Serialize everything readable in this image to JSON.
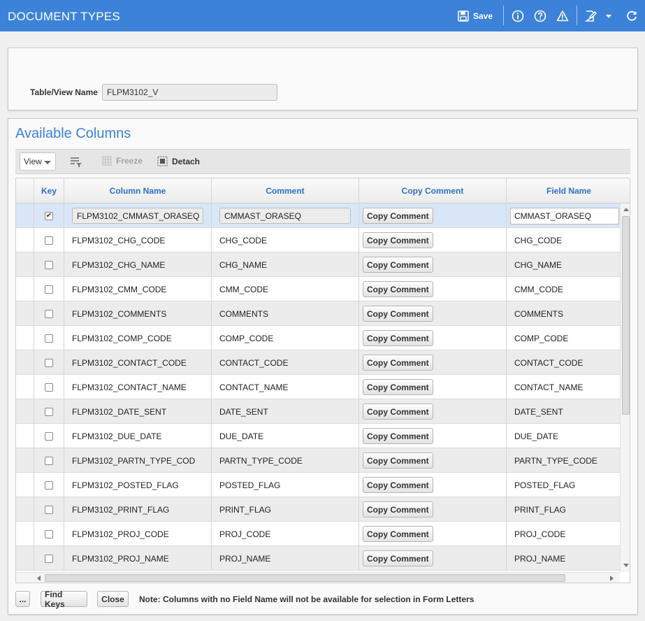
{
  "window": {
    "title": "DOCUMENT TYPES",
    "save_label": "Save"
  },
  "table_view": {
    "label": "Table/View Name",
    "value": "FLPM3102_V"
  },
  "section": {
    "title": "Available Columns"
  },
  "grid_toolbar": {
    "view_label": "View",
    "freeze_label": "Freeze",
    "detach_label": "Detach"
  },
  "grid": {
    "headers": {
      "key": "Key",
      "column_name": "Column Name",
      "comment": "Comment",
      "copy_comment": "Copy Comment",
      "field_name": "Field Name"
    },
    "copy_button_label": "Copy Comment",
    "rows": [
      {
        "key": true,
        "column": "FLPM3102_CMMAST_ORASEQ",
        "comment": "CMMAST_ORASEQ",
        "field": "CMMAST_ORASEQ"
      },
      {
        "key": false,
        "column": "FLPM3102_CHG_CODE",
        "comment": "CHG_CODE",
        "field": "CHG_CODE"
      },
      {
        "key": false,
        "column": "FLPM3102_CHG_NAME",
        "comment": "CHG_NAME",
        "field": "CHG_NAME"
      },
      {
        "key": false,
        "column": "FLPM3102_CMM_CODE",
        "comment": "CMM_CODE",
        "field": "CMM_CODE"
      },
      {
        "key": false,
        "column": "FLPM3102_COMMENTS",
        "comment": "COMMENTS",
        "field": "COMMENTS"
      },
      {
        "key": false,
        "column": "FLPM3102_COMP_CODE",
        "comment": "COMP_CODE",
        "field": "COMP_CODE"
      },
      {
        "key": false,
        "column": "FLPM3102_CONTACT_CODE",
        "comment": "CONTACT_CODE",
        "field": "CONTACT_CODE"
      },
      {
        "key": false,
        "column": "FLPM3102_CONTACT_NAME",
        "comment": "CONTACT_NAME",
        "field": "CONTACT_NAME"
      },
      {
        "key": false,
        "column": "FLPM3102_DATE_SENT",
        "comment": "DATE_SENT",
        "field": "DATE_SENT"
      },
      {
        "key": false,
        "column": "FLPM3102_DUE_DATE",
        "comment": "DUE_DATE",
        "field": "DUE_DATE"
      },
      {
        "key": false,
        "column": "FLPM3102_PARTN_TYPE_COD",
        "comment": "PARTN_TYPE_CODE",
        "field": "PARTN_TYPE_CODE"
      },
      {
        "key": false,
        "column": "FLPM3102_POSTED_FLAG",
        "comment": "POSTED_FLAG",
        "field": "POSTED_FLAG"
      },
      {
        "key": false,
        "column": "FLPM3102_PRINT_FLAG",
        "comment": "PRINT_FLAG",
        "field": "PRINT_FLAG"
      },
      {
        "key": false,
        "column": "FLPM3102_PROJ_CODE",
        "comment": "PROJ_CODE",
        "field": "PROJ_CODE"
      },
      {
        "key": false,
        "column": "FLPM3102_PROJ_NAME",
        "comment": "PROJ_NAME",
        "field": "PROJ_NAME"
      }
    ]
  },
  "footer": {
    "more_label": "...",
    "find_keys_label": "Find Keys",
    "close_label": "Close",
    "note": "Note: Columns with no Field Name will not be available for selection in Form Letters"
  },
  "colors": {
    "accent": "#3d82d9",
    "header_text": "#2f6fc4",
    "selected_row": "#d9e6f7"
  },
  "icons": [
    "save-icon",
    "info-icon",
    "help-icon",
    "warning-icon",
    "edit-icon",
    "dropdown-icon",
    "refresh-icon",
    "filter-icon",
    "freeze-icon",
    "detach-icon"
  ]
}
